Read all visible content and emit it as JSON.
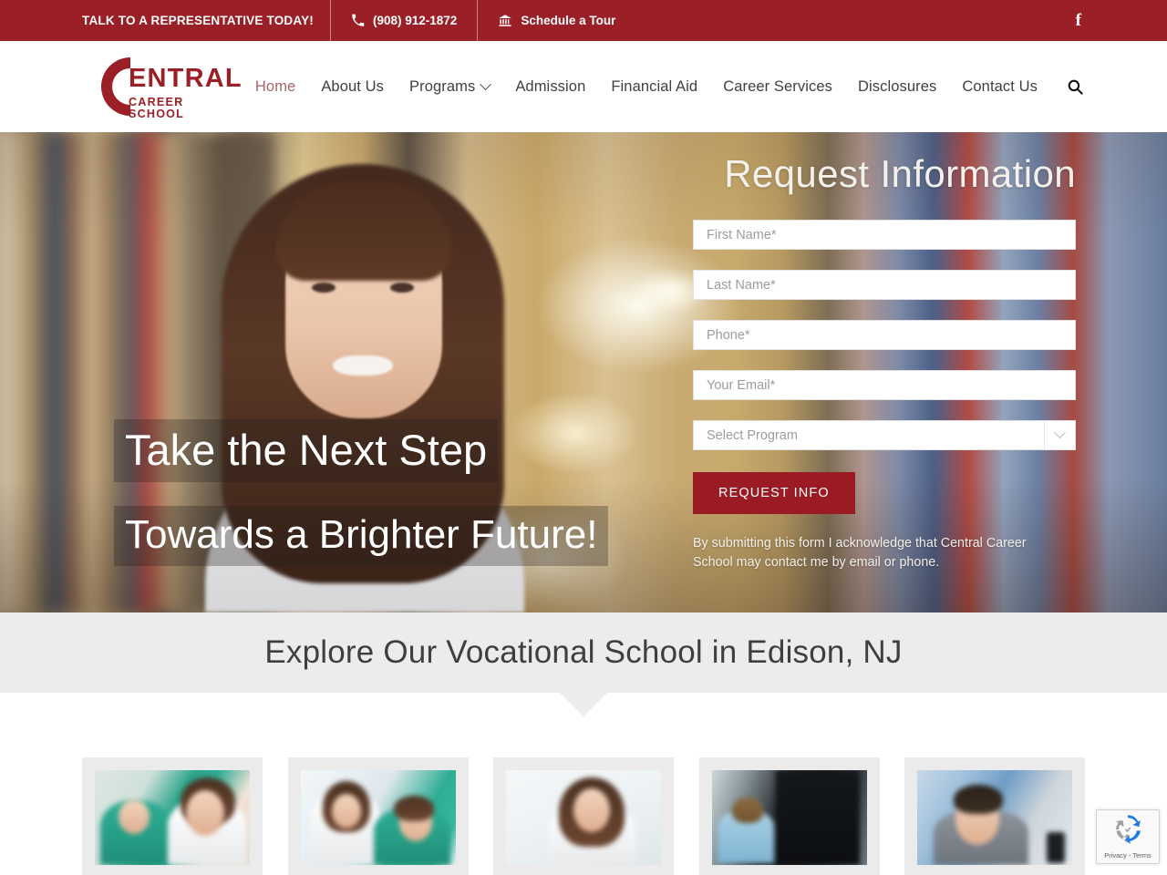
{
  "brand": {
    "name_main": "ENTRAL",
    "name_sub": "CAREER SCHOOL",
    "color_primary": "#9B1F26",
    "color_button": "#9B1B24",
    "color_nav_active": "#A8666A"
  },
  "topbar": {
    "tagline": "TALK TO A REPRESENTATIVE TODAY!",
    "phone": "(908) 912-1872",
    "tour_label": "Schedule a Tour",
    "phone_icon": "phone-icon",
    "tour_icon": "bank-columns-icon",
    "social_icon": "facebook-icon",
    "facebook_glyph": "f"
  },
  "nav": {
    "items": [
      {
        "label": "Home",
        "active": true,
        "has_dropdown": false
      },
      {
        "label": "About Us",
        "active": false,
        "has_dropdown": false
      },
      {
        "label": "Programs",
        "active": false,
        "has_dropdown": true
      },
      {
        "label": "Admission",
        "active": false,
        "has_dropdown": false
      },
      {
        "label": "Financial Aid",
        "active": false,
        "has_dropdown": false
      },
      {
        "label": "Career Services",
        "active": false,
        "has_dropdown": false
      },
      {
        "label": "Disclosures",
        "active": false,
        "has_dropdown": false
      },
      {
        "label": "Contact Us",
        "active": false,
        "has_dropdown": false
      }
    ],
    "search_icon": "search-icon"
  },
  "hero": {
    "headline_line1": "Take the Next Step",
    "headline_line2": "Towards a Brighter Future!",
    "image_alt": "smiling-student-in-library"
  },
  "form": {
    "title": "Request Information",
    "fields": [
      {
        "name": "first-name-field",
        "placeholder": "First Name*",
        "value": ""
      },
      {
        "name": "last-name-field",
        "placeholder": "Last Name*",
        "value": ""
      },
      {
        "name": "phone-field",
        "placeholder": "Phone*",
        "value": ""
      },
      {
        "name": "email-field",
        "placeholder": "Your Email*",
        "value": ""
      }
    ],
    "select": {
      "name": "program-select",
      "placeholder": "Select Program",
      "value": "",
      "arrow_icon": "chevron-down-icon"
    },
    "submit_label": "REQUEST INFO",
    "disclaimer": "By submitting this form I acknowledge that Central Career School may contact me by email or phone."
  },
  "section": {
    "title": "Explore Our Vocational School in Edison, NJ"
  },
  "cards": [
    {
      "name": "card-dental-assistant",
      "image_alt": "dental-assistant-with-patient"
    },
    {
      "name": "card-medical-assistant",
      "image_alt": "medical-staff-with-phone"
    },
    {
      "name": "card-medical-office",
      "image_alt": "woman-in-white-coat-at-desk"
    },
    {
      "name": "card-it-networking",
      "image_alt": "technician-at-server-rack"
    },
    {
      "name": "card-business",
      "image_alt": "businessman-with-smartphone"
    }
  ],
  "recaptcha": {
    "label": "Privacy - Terms",
    "logo_icon": "recaptcha-logo-icon"
  }
}
